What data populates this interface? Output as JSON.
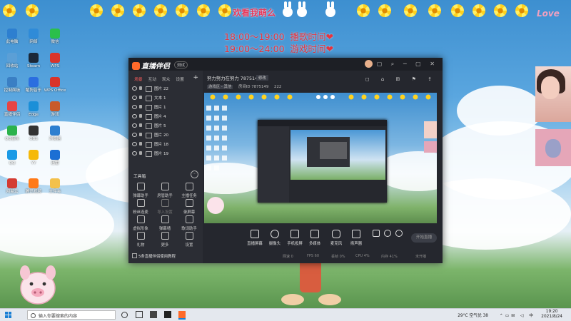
{
  "desktop": {
    "banner_text": "欢看我萌么",
    "love_text": "Love",
    "schedule": [
      {
        "time": "18:00～19:00",
        "activity": "播歌时间"
      },
      {
        "time": "19:00～24:00",
        "activity": "游戏时间"
      }
    ],
    "heart_glyph": "❤",
    "icons": [
      {
        "label": "此电脑",
        "color": "#2d7fd0"
      },
      {
        "label": "网络",
        "color": "#2f8bd8"
      },
      {
        "label": "微信",
        "color": "#2bbf4b"
      },
      {
        "label": "回收站",
        "color": "#5b9fd6"
      },
      {
        "label": "Steam",
        "color": "#1b2838"
      },
      {
        "label": "WPS",
        "color": "#d9342b"
      },
      {
        "label": "控制面板",
        "color": "#3a7fc4"
      },
      {
        "label": "酷狗音乐",
        "color": "#2b6ee0"
      },
      {
        "label": "WPS Office",
        "color": "#d9342b"
      },
      {
        "label": "直播伴侣",
        "color": "#e64545"
      },
      {
        "label": "Edge",
        "color": "#1b8fd8"
      },
      {
        "label": "游戏",
        "color": "#c85a2a"
      },
      {
        "label": "QQ音乐",
        "color": "#2bb24c"
      },
      {
        "label": "OBS",
        "color": "#333333"
      },
      {
        "label": "浏览器",
        "color": "#2d7fd0"
      },
      {
        "label": "QQ",
        "color": "#1a9ae6"
      },
      {
        "label": "YY",
        "color": "#f5b90a"
      },
      {
        "label": "迅雷",
        "color": "#1c6fd4"
      },
      {
        "label": "网易云",
        "color": "#d43c33"
      },
      {
        "label": "腾讯视频",
        "color": "#ff7a18"
      },
      {
        "label": "文件夹",
        "color": "#f3c14b"
      }
    ]
  },
  "app": {
    "logo": "直播伴侣",
    "version_badge": "测试",
    "window_controls": "▢ ⌕ ─ ▢ ✕",
    "tabs": [
      {
        "label": "场景",
        "active": true
      },
      {
        "label": "互动"
      },
      {
        "label": "观众"
      },
      {
        "label": "设置"
      }
    ],
    "tabs_add": "+",
    "scenes": [
      {
        "label": "图片 22"
      },
      {
        "label": "文本 1"
      },
      {
        "label": "图片 1"
      },
      {
        "label": "图片 4"
      },
      {
        "label": "图片 5"
      },
      {
        "label": "图片 20"
      },
      {
        "label": "图片 18"
      },
      {
        "label": "图片 19"
      }
    ],
    "tools_title": "工具箱",
    "tools_more": "⋯",
    "tools": [
      {
        "label": "弹幕助手",
        "color": "#bbbbbb"
      },
      {
        "label": "房管助手",
        "color": "#bbbbbb"
      },
      {
        "label": "主播任务",
        "color": "#bbbbbb"
      },
      {
        "label": "粉丝连麦",
        "color": "#bbbbbb"
      },
      {
        "label": "导入设置",
        "color": "#777777"
      },
      {
        "label": "录屏幕",
        "color": "#bbbbbb"
      },
      {
        "label": "虚拟形象",
        "color": "#bbbbbb"
      },
      {
        "label": "弹幕墙",
        "color": "#bbbbbb"
      },
      {
        "label": "歌词助手",
        "color": "#bbbbbb"
      },
      {
        "label": "礼物",
        "color": "#bbbbbb"
      },
      {
        "label": "更多",
        "color": "#bbbbbb"
      },
      {
        "label": "设置",
        "color": "#bbbbbb"
      }
    ],
    "sidebar_footer": "5条直播伴侣使用教程",
    "room": {
      "title": "努力努力在努力 7875149",
      "modify": "修改",
      "meta": [
        "游戏区 - 其他",
        "房间ID 7875149",
        "222"
      ]
    },
    "right_tools": "◻ ⌂ ⊞ ⚑ ⇪",
    "controls": [
      {
        "label": "直播屏幕"
      },
      {
        "label": "摄像头"
      },
      {
        "label": "手机投屏"
      },
      {
        "label": "多媒体"
      },
      {
        "label": "麦克风"
      },
      {
        "label": "扬声器"
      }
    ],
    "go_live": "开始直播",
    "status_items": [
      "网速 0",
      "FPS 60",
      "丢帧 0%",
      "CPU 4%",
      "内存 41%",
      "未开播"
    ]
  },
  "taskbar": {
    "search_placeholder": "输入你要搜索的内容",
    "weather": "29°C 空气优 38",
    "time": "19:20",
    "date": "2021/8/24"
  }
}
